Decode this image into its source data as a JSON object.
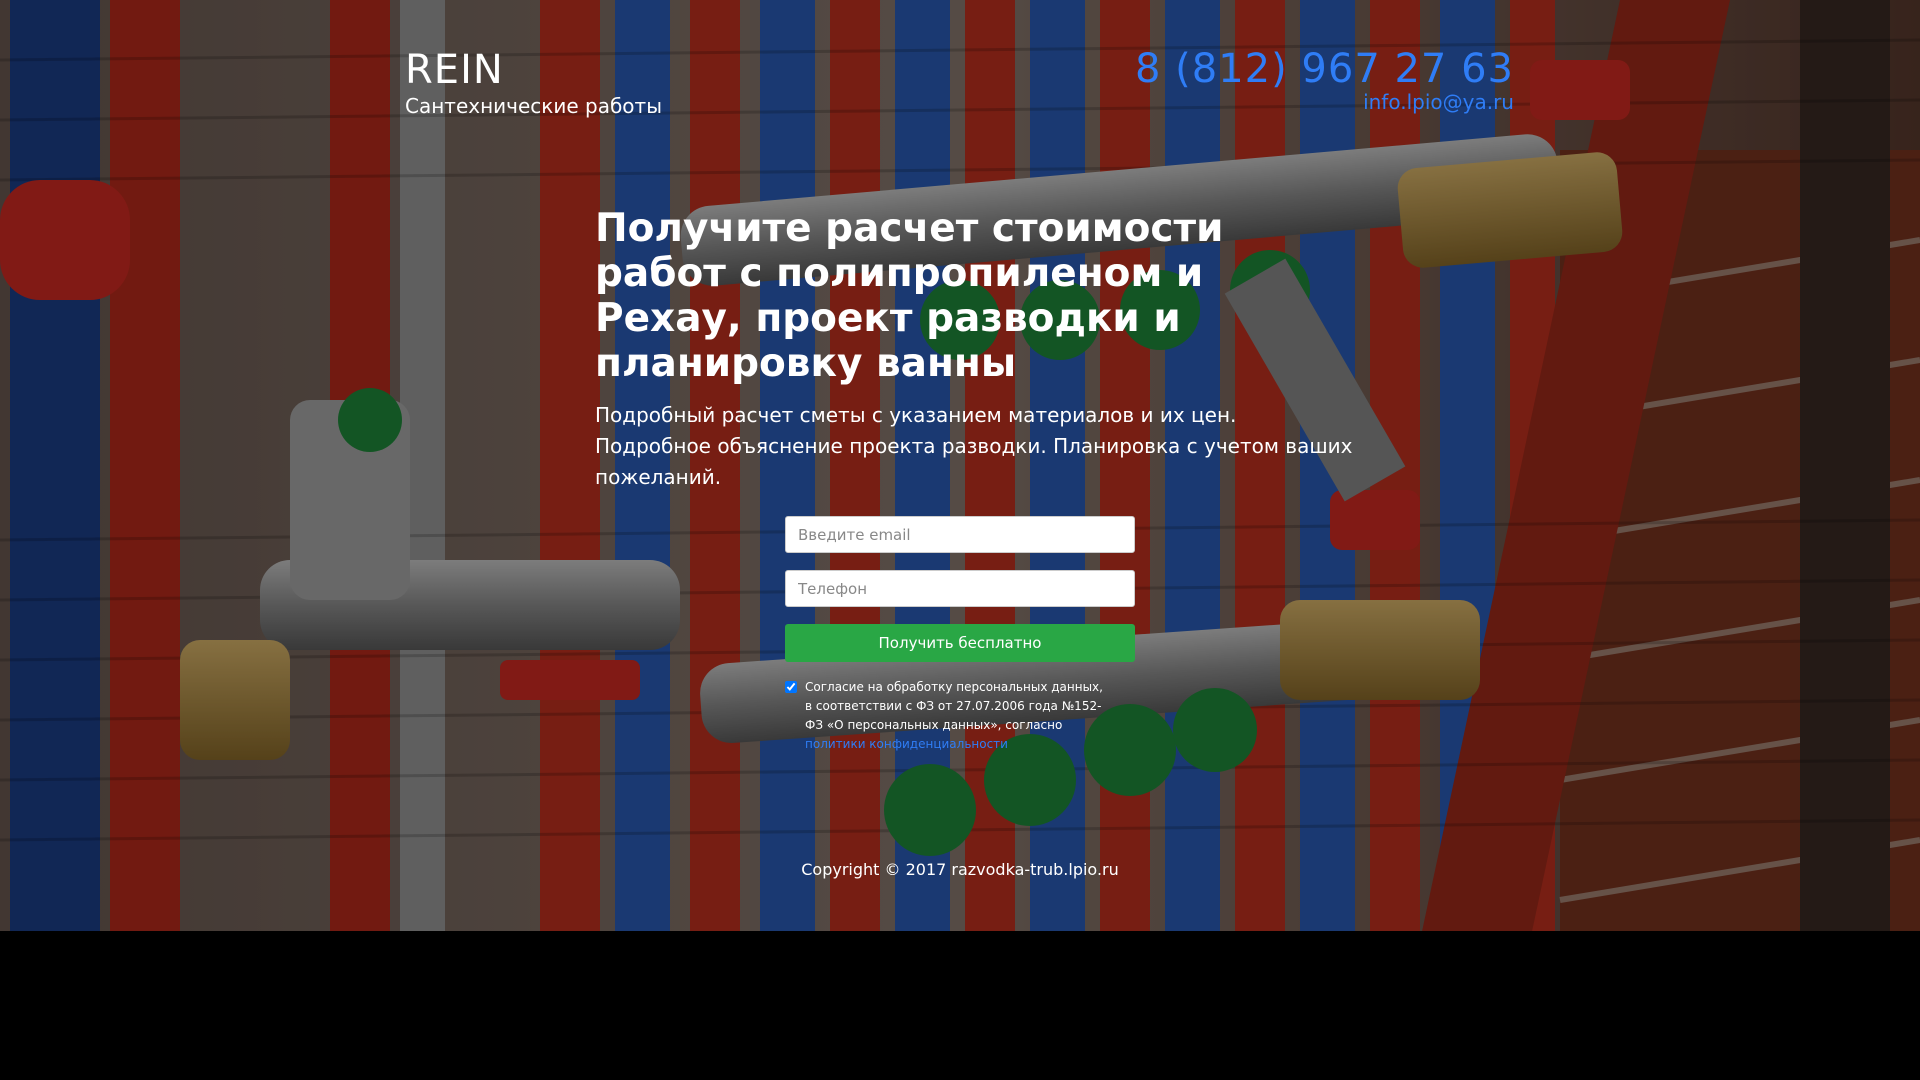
{
  "header": {
    "brand_name": "REIN",
    "tagline": "Сантехнические работы",
    "phone": "8 (812) 967 27 63",
    "email": "info.lpio@ya.ru"
  },
  "hero": {
    "headline": "Получите расчет стоимости работ с полипропиленом и Рехау, проект разводки и планировку ванны",
    "lead": "Подробный расчет сметы с указанием материалов и их цен. Подробное объяснение проекта разводки. Планировка с учетом ваших пожеланий."
  },
  "form": {
    "email_placeholder": "Введите email",
    "phone_placeholder": "Телефон",
    "submit_label": "Получить бесплатно",
    "consent_checked": true,
    "consent_text": "Согласие на обработку персональных данных, в соответствии с ФЗ от 27.07.2006 года №152-ФЗ «О персональных данных», согласно ",
    "consent_link": "политики конфиденциальности"
  },
  "footer": {
    "copyright": "Copyright © 2017 razvodka-trub.lpio.ru"
  },
  "colors": {
    "accent_link": "#2f7df6",
    "button_green": "#29a745",
    "page_bottom": "#000000"
  },
  "background": {
    "icon": "plumbing-manifold-photo"
  }
}
